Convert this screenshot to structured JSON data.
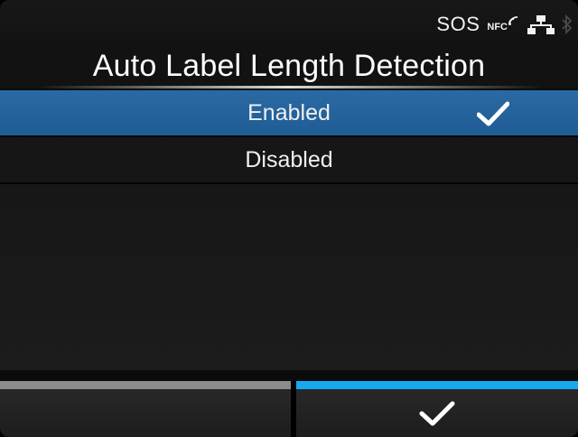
{
  "status_bar": {
    "sos_text": "SOS",
    "nfc_text": "NFC",
    "icons": [
      "nfc-icon",
      "lan-icon",
      "bluetooth-icon"
    ]
  },
  "header": {
    "title": "Auto Label Length Detection"
  },
  "options": [
    {
      "label": "Enabled",
      "selected": true,
      "checked": true
    },
    {
      "label": "Disabled",
      "selected": false,
      "checked": false
    }
  ],
  "softkeys": {
    "left": {
      "label": "",
      "strip_color": "#8c8c8c"
    },
    "right": {
      "icon": "check-icon",
      "strip_color": "#17a9f0"
    }
  },
  "colors": {
    "selection": "#2566a0",
    "accent": "#17a9f0"
  }
}
